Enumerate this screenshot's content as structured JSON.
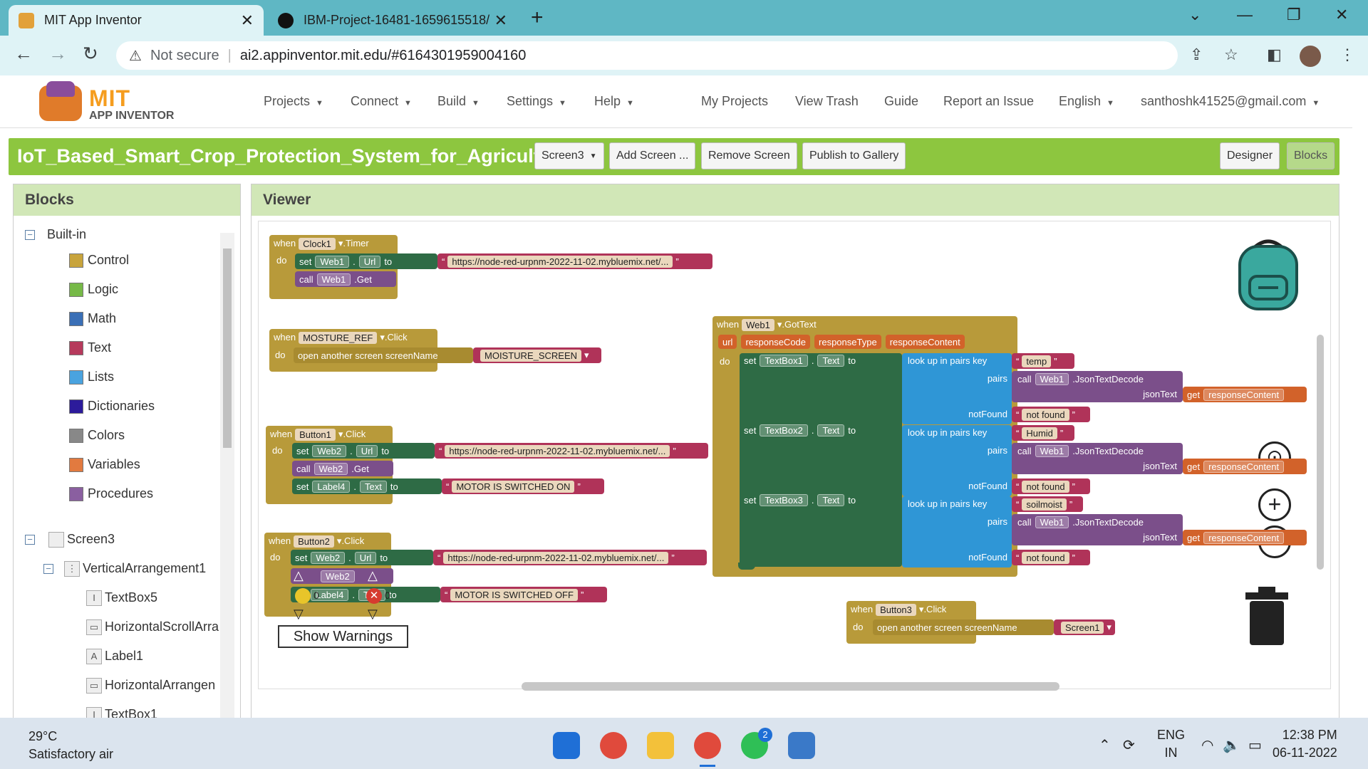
{
  "browser": {
    "tabs": [
      {
        "title": "MIT App Inventor",
        "active": true
      },
      {
        "title": "IBM-Project-16481-1659615518/",
        "active": false
      }
    ],
    "new_tab": "+",
    "not_secure": "Not secure",
    "url": "ai2.appinventor.mit.edu/#6164301959004160"
  },
  "header": {
    "logo_mit": "MIT",
    "logo_ai": "APP INVENTOR",
    "menus": [
      "Projects",
      "Connect",
      "Build",
      "Settings",
      "Help"
    ],
    "links": [
      "My Projects",
      "View Trash",
      "Guide",
      "Report an Issue"
    ],
    "language": "English",
    "account": "santhoshk41525@gmail.com"
  },
  "project": {
    "name": "IoT_Based_Smart_Crop_Protection_System_for_Agriculture",
    "screen_select": "Screen3",
    "buttons": [
      "Add Screen ...",
      "Remove Screen",
      "Publish to Gallery"
    ],
    "designer": "Designer",
    "blocks": "Blocks"
  },
  "blocks_panel": {
    "title": "Blocks",
    "builtin": "Built-in",
    "categories": [
      {
        "label": "Control",
        "color": "#c8a43c"
      },
      {
        "label": "Logic",
        "color": "#76b947"
      },
      {
        "label": "Math",
        "color": "#3a6fb6"
      },
      {
        "label": "Text",
        "color": "#b63a5c"
      },
      {
        "label": "Lists",
        "color": "#4aa3df"
      },
      {
        "label": "Dictionaries",
        "color": "#2c1b9b"
      },
      {
        "label": "Colors",
        "color": "#888888"
      },
      {
        "label": "Variables",
        "color": "#e27a3f"
      },
      {
        "label": "Procedures",
        "color": "#8a5fa0"
      }
    ],
    "screen": "Screen3",
    "components": [
      "VerticalArrangement1",
      "TextBox5",
      "HorizontalScrollArra",
      "Label1",
      "HorizontalArrangen",
      "TextBox1"
    ]
  },
  "viewer": {
    "title": "Viewer",
    "show_warnings": "Show Warnings",
    "warn_count": "0",
    "error_count": "0"
  },
  "blocks_text": {
    "when": "when",
    "do": "do",
    "set": "set",
    "call": "call",
    "to": "to",
    "get": "get",
    "url": "url",
    "clock1": "Clock1",
    "timer": ".Timer",
    "web1": "Web1",
    "web2": "Web2",
    "url_prop": "Url",
    "get_m": ".Get",
    "url1": "https://node-red-urpnm-2022-11-02.mybluemix.net/...",
    "moisture_ref": "MOSTURE_REF",
    "click": ".Click",
    "open_screen": "open another screen",
    "screen_name": "screenName",
    "moisture_screen": "MOISTURE_SCREEN",
    "button1": "Button1",
    "button2": "Button2",
    "button3": "Button3",
    "label4": "Label4",
    "text_prop": "Text",
    "motor_on": "MOTOR IS SWITCHED ON",
    "motor_off": "MOTOR IS SWITCHED OFF",
    "gottext": ".GotText",
    "params": [
      "responseCode",
      "responseType",
      "responseContent"
    ],
    "textbox1": "TextBox1",
    "textbox2": "TextBox2",
    "textbox3": "TextBox3",
    "lookup": "look up in pairs",
    "key": "key",
    "pairs": "pairs",
    "notfound": "notFound",
    "jsondecode": ".JsonTextDecode",
    "jsontext": "jsonText",
    "response_content": "responseContent",
    "temp": "temp",
    "humid": "Humid",
    "soilmoist": "soilmoist",
    "not_found": "not found",
    "screen1": "Screen1"
  },
  "taskbar": {
    "temperature": "29°C",
    "air": "Satisfactory air",
    "whatsapp_badge": "2",
    "lang1": "ENG",
    "lang2": "IN",
    "time": "12:38 PM",
    "date": "06-11-2022"
  }
}
